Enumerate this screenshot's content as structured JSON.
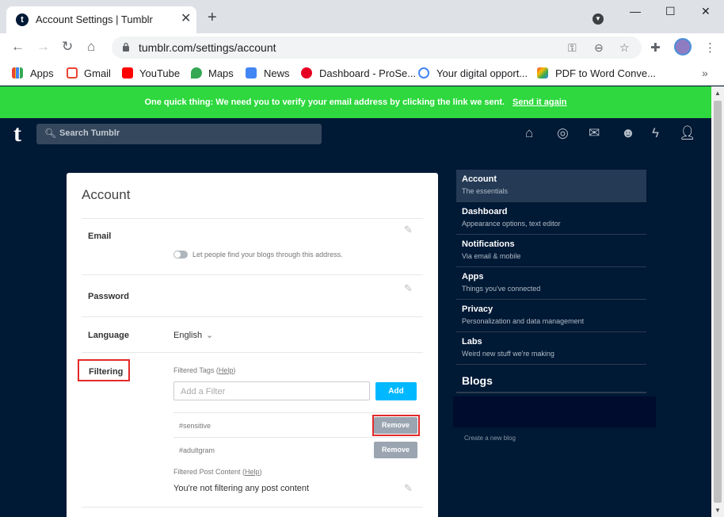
{
  "browser": {
    "tab_title": "Account Settings | Tumblr",
    "tab_favicon": "t",
    "url": "tumblr.com/settings/account",
    "bookmarks": [
      {
        "label": "Apps",
        "icon": "apps-grid-icon"
      },
      {
        "label": "Gmail",
        "icon": "gmail-icon"
      },
      {
        "label": "YouTube",
        "icon": "youtube-icon"
      },
      {
        "label": "Maps",
        "icon": "maps-icon"
      },
      {
        "label": "News",
        "icon": "news-icon"
      },
      {
        "label": "Dashboard - ProSe...",
        "icon": "pinterest-icon"
      },
      {
        "label": "Your digital opport...",
        "icon": "google-icon"
      },
      {
        "label": "PDF to Word Conve...",
        "icon": "pdf-icon"
      }
    ]
  },
  "banner": {
    "text": "One quick thing:  We need you to verify your email address by clicking the link we sent.",
    "link": "Send it again",
    "color": "#2ed83e"
  },
  "header": {
    "logo": "t",
    "search_placeholder": "Search Tumblr"
  },
  "account": {
    "title": "Account",
    "email_label": "Email",
    "email_toggle_text": "Let people find your blogs through this address.",
    "password_label": "Password",
    "language_label": "Language",
    "language_value": "English",
    "filtering_label": "Filtering",
    "filtered_tags_label": "Filtered Tags (",
    "help_link": "Help",
    "close_paren": ")",
    "filter_placeholder": "Add a Filter",
    "add_button": "Add",
    "tags": [
      {
        "tag": "#sensitive",
        "button": "Remove"
      },
      {
        "tag": "#adultgram",
        "button": "Remove"
      }
    ],
    "filtered_post_label": "Filtered Post Content (",
    "post_content_text": "You're not filtering any post content"
  },
  "sidebar": {
    "items": [
      {
        "title": "Account",
        "subtitle": "The essentials",
        "active": true
      },
      {
        "title": "Dashboard",
        "subtitle": "Appearance options, text editor"
      },
      {
        "title": "Notifications",
        "subtitle": "Via email & mobile"
      },
      {
        "title": "Apps",
        "subtitle": "Things you've connected"
      },
      {
        "title": "Privacy",
        "subtitle": "Personalization and data management"
      },
      {
        "title": "Labs",
        "subtitle": "Weird new stuff we're making"
      }
    ],
    "blogs_heading": "Blogs",
    "create_blog": "Create a new blog"
  },
  "colors": {
    "background": "#001935",
    "accent": "#00b8ff",
    "highlight": "#e32a2a"
  }
}
